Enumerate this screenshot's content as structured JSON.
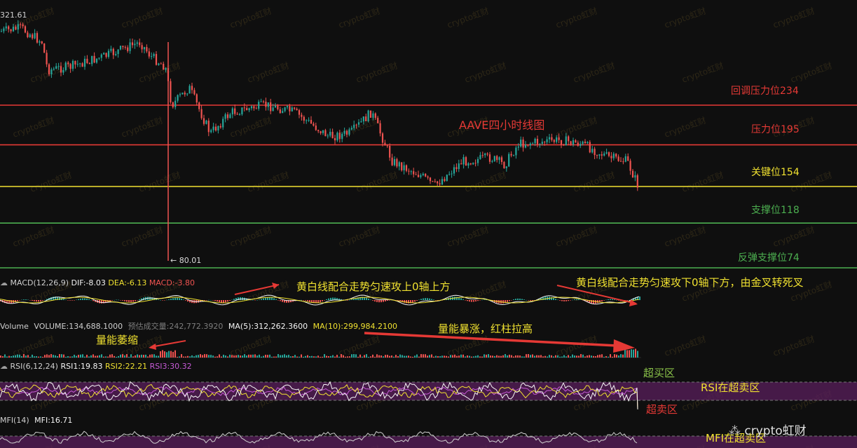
{
  "price_panel": {
    "top_price_label": "321.61",
    "low_marker": "← 80.01",
    "title": "AAVE四小时线图"
  },
  "levels": [
    {
      "label": "回调压力位234",
      "value": 234,
      "color": "#e53935"
    },
    {
      "label": "压力位195",
      "value": 195,
      "color": "#e53935"
    },
    {
      "label": "关键位154",
      "value": 154,
      "color": "#f0e130"
    },
    {
      "label": "支撑位118",
      "value": 118,
      "color": "#4caf50"
    },
    {
      "label": "反弹支撑位74",
      "value": 74,
      "color": "#4caf50"
    }
  ],
  "macd": {
    "name": "MACD(12,26,9)",
    "dif": "DIF:-8.03",
    "dea": "DEA:-6.13",
    "macd": "MACD:-3.80",
    "note1": "黄白线配合走势匀速攻上0轴上方",
    "note2": "黄白线配合走势匀速攻下0轴下方，由金叉转死叉"
  },
  "volume": {
    "name": "Volume",
    "volume": "VOLUME:134,688.1000",
    "est": "预估成交量:242,772.3920",
    "ma5": "MA(5):312,262.3600",
    "ma10": "MA(10):299,984.2100",
    "note_shrink": "量能萎缩",
    "note_surge": "量能暴涨，红柱拉高"
  },
  "rsi": {
    "name": "RSI(6,12,24)",
    "rsi1": "RSI1:19.83",
    "rsi2": "RSI2:22.21",
    "rsi3": "RSI3:30.32",
    "overbought": "超买区",
    "oversold_note": "RSI在超卖区",
    "oversold": "超卖区"
  },
  "mfi": {
    "name": "MFI(14)",
    "value": "MFI:16.71",
    "note": "MFI在超卖区"
  },
  "watermark": {
    "text": "crypto虹财",
    "brand": "crypto虹财"
  },
  "colors": {
    "up": "#26a69a",
    "down": "#ef5350",
    "dif": "#f5f5f5",
    "dea": "#f0e130",
    "rsi3": "#c65ad6",
    "zone": "#5a1f5c"
  }
}
